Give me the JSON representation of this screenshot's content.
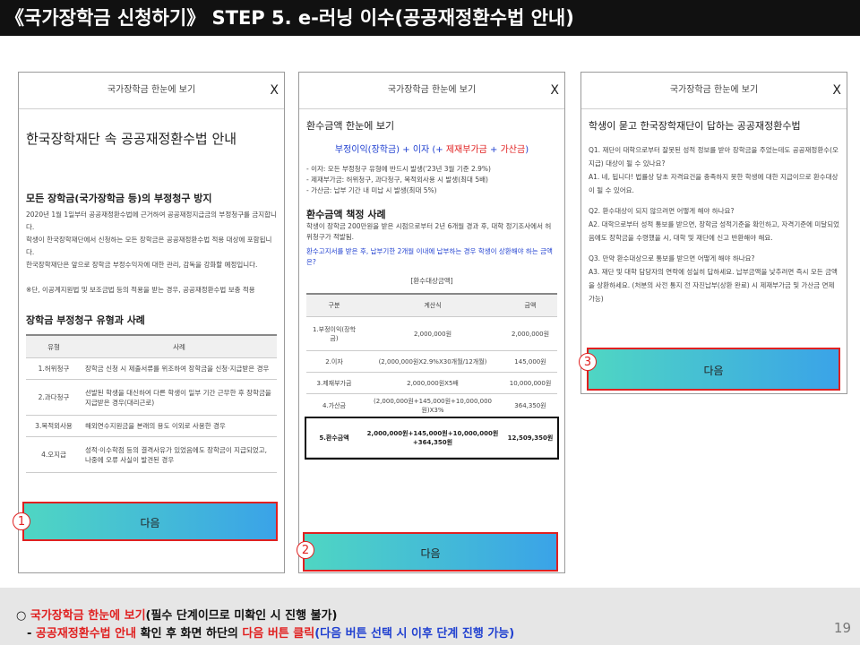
{
  "title": "《국가장학금 신청하기》 STEP 5. e-러닝 이수(공공재정환수법 안내)",
  "modal_header": "국가장학금 한눈에 보기",
  "close_symbol": "X",
  "next_label": "다음",
  "badges": [
    "1",
    "2",
    "3"
  ],
  "panel1": {
    "heading": "한국장학재단 속 공공재정환수법 안내",
    "sub1": "모든 장학금(국가장학금 등)의 부정청구 방지",
    "para": [
      "2020년 1월 1일부터 공공재정환수법에 근거하여 공공재정지급금의 부정청구를 금지합니다.",
      "학생이 한국장학재단에서 신청하는 모든 장학금은 공공재정환수법 적용 대상에 포함됩니다.",
      "한국장학재단은 앞으로 장학금 부정수익자에 대한 관리, 감독을 강화할 예정입니다."
    ],
    "note": "※단, 이공계지원법 및 보조금법 등의 적용을 받는 경우, 공공재정환수법 보충 적용",
    "sub2": "장학금 부정청구 유형과 사례",
    "table_headers": [
      "유형",
      "사례"
    ],
    "rows": [
      {
        "type": "1.허위청구",
        "case": "장학금 신청 시 제출서류를 위조하여 장학금을 신청·지급받은 경우"
      },
      {
        "type": "2.과다청구",
        "case": "선발된 학생을 대신하여 다른 학생이 일부 기간 근무한 후 장학금을 지급받은 경우(대리근로)"
      },
      {
        "type": "3.목적외사용",
        "case": "해외연수지원금을 본래의 용도 이외로 사용한 경우"
      },
      {
        "type": "4.오지급",
        "case": "성적·이수학점 등의 결격사유가 있었음에도 장학금이 지급되었고, 나중에 오류 사실이 발견된 경우"
      }
    ]
  },
  "panel2": {
    "heading": "환수금액 한눈에 보기",
    "formula_a": "부정이익(장학금) + 이자 (+ ",
    "formula_b": "제재부가금",
    "formula_c": " + ",
    "formula_d": "가산금",
    "formula_e": ")",
    "bullets": [
      "- 이자: 모든 부정청구 유형에 반드시 발생('23년 3월 기준 2.9%)",
      "- 제재부가금: 허위청구, 과다청구, 목적외사용 시 발생(최대 5배)",
      "- 가산금: 납부 기간 내 미납 시 발생(최대 5%)"
    ],
    "sub": "환수금액 책정 사례",
    "case_text": "학생이 장학금 200만원을 받은 시점으로부터 2년 6개월 경과 후, 대학 정기조사에서 허위청구가 적발됨.",
    "question": "환수고지서를 받은 후, 납부기한 2개월 이내에 납부하는 경우 학생이 상환해야 하는 금액은?",
    "table_caption": "[환수대상금액]",
    "table_headers": [
      "구분",
      "계산식",
      "금액"
    ],
    "rows": [
      {
        "k": "1.부정이익(장학금)",
        "f": "2,000,000원",
        "v": "2,000,000원"
      },
      {
        "k": "2.이자",
        "f": "(2,000,000원X2.9%X30개월/12개월)",
        "v": "145,000원"
      },
      {
        "k": "3.제재부가금",
        "f": "2,000,000원X5배",
        "v": "10,000,000원"
      },
      {
        "k": "4.가산금",
        "f": "(2,000,000원+145,000원+10,000,000원)X3%",
        "v": "364,350원"
      },
      {
        "k": "5.환수금액",
        "f": "2,000,000원+145,000원+10,000,000원 +364,350원",
        "v": "12,509,350원"
      }
    ]
  },
  "panel3": {
    "heading": "학생이 묻고 한국장학재단이 답하는 공공재정환수법",
    "qa": [
      "Q1. 재단이 대학으로부터 잘못된 성적 정보를 받아 장학금을 주었는데도 공공재정환수(오지급) 대상이 될 수 있나요?",
      "A1. 네, 됩니다! 법률상 당초 자격요건을 충족하지 못한 학생에 대한 지급이므로 환수대상이 될 수 있어요.",
      "Q2. 환수대상이 되지 않으려면 어떻게 해야 하나요?",
      "A2. 대학으로부터 성적 통보를 받으면, 장학금 성적기준을 확인하고, 자격기준에 미달되었음에도 장학금을 수령했을 시, 대학 및 재단에 신고 반환해야 해요.",
      "Q3. 만약 환수대상으로 통보를 받으면 어떻게 해야 하나요?",
      "A3. 재단 및 대학 담당자의 연락에 성실히 답하세요. 납부금액을 낮추려면 즉시 모든 금액을 상환하세요. (처분의 사전 통지 전 자진납부(상환 완료) 시 제재부가금 및 가산금 면제 가능)"
    ]
  },
  "footer": {
    "line1_bullet": "○ ",
    "line1_red": "국가장학금 한눈에 보기",
    "line1_rest": "(필수 단계이므로 미확인 시 진행 불가)",
    "line2_dash": "- ",
    "line2_red1": "공공재정환수법 안내",
    "line2_mid": " 확인 후 화면 하단의 ",
    "line2_red2": "다음 버튼 클릭",
    "line2_blue": "(다음 버튼 선택 시 이후 단계 진행 가능)"
  },
  "page_number": "19",
  "colors": {
    "accent_red": "#e02020",
    "accent_blue": "#2040d0",
    "btn_from": "#4fd6c3",
    "btn_to": "#3aa3e8"
  }
}
